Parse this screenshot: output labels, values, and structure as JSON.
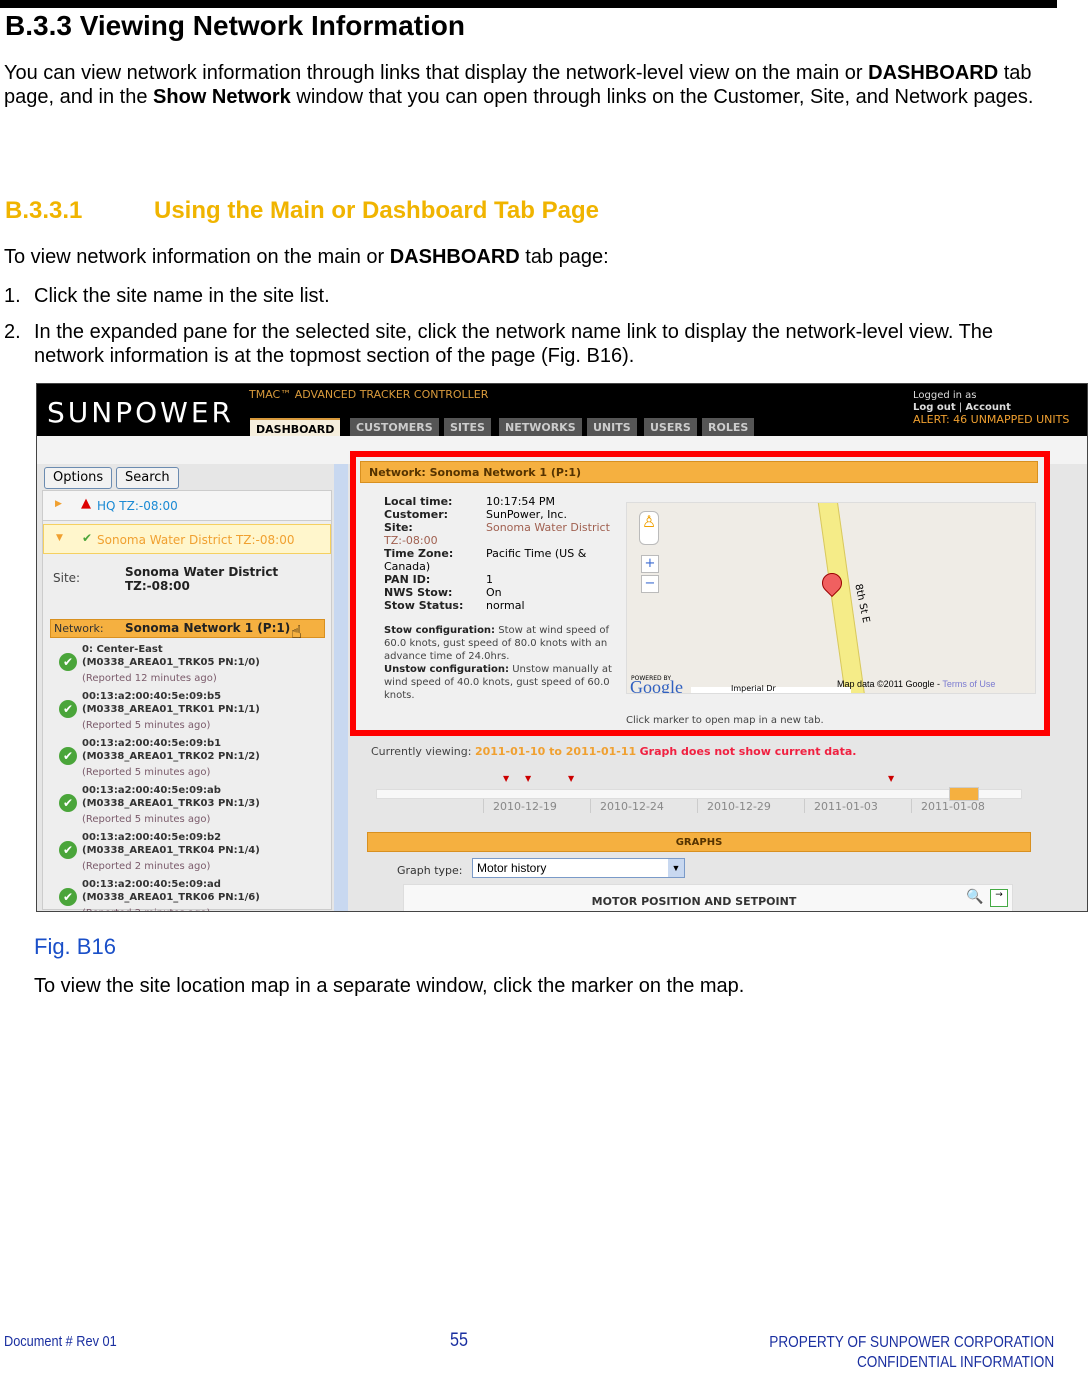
{
  "heading": "B.3.3 Viewing Network Information",
  "intro": {
    "t1": "You can view network information through links that display the network-level view on the main or ",
    "b1": "DASHBOARD",
    "t2": " tab page, and in the ",
    "b2": "Show Network",
    "t3": " window that you can open through links on the Customer, Site, and Network pages."
  },
  "section": {
    "number": "B.3.3.1",
    "title": "Using the Main or Dashboard Tab Page"
  },
  "lead": {
    "t1": "To view network information on the main or ",
    "b1": "DASHBOARD",
    "t2": " tab page:"
  },
  "steps": [
    {
      "n": "1.",
      "text": "Click the site name in the site list."
    },
    {
      "n": "2.",
      "text": "In the expanded pane for the selected site, click the network name link to display the network-level view. The network information is at the topmost section of the page (Fig. B16)."
    }
  ],
  "app": {
    "logo": "SUNPOWER",
    "product": "TMAC™ ADVANCED TRACKER CONTROLLER",
    "tabs": [
      "DASHBOARD",
      "CUSTOMERS",
      "SITES",
      "NETWORKS",
      "UNITS",
      "USERS",
      "ROLES"
    ],
    "logged_in": "Logged in as",
    "logout": "Log out",
    "sep": "|",
    "account": "Account",
    "alert": "ALERT: 46 UNMAPPED UNITS",
    "options": "Options",
    "search": "Search",
    "site_hq": "HQ TZ:-08:00",
    "site_sonoma": "Sonoma Water District TZ:-08:00",
    "site_label": "Site:",
    "site_value": "Sonoma Water District TZ:-08:00",
    "network_label": "Network:",
    "network_value": "Sonoma Network 1 (P:1)",
    "units": [
      {
        "id": "0: Center-East (M0338_AREA01_TRK05 PN:1/0)",
        "reported": "(Reported 12 minutes ago)"
      },
      {
        "id": "00:13:a2:00:40:5e:09:b5 (M0338_AREA01_TRK01 PN:1/1)",
        "reported": "(Reported 5 minutes ago)"
      },
      {
        "id": "00:13:a2:00:40:5e:09:b1 (M0338_AREA01_TRK02 PN:1/2)",
        "reported": "(Reported 5 minutes ago)"
      },
      {
        "id": "00:13:a2:00:40:5e:09:ab (M0338_AREA01_TRK03 PN:1/3)",
        "reported": "(Reported 5 minutes ago)"
      },
      {
        "id": "00:13:a2:00:40:5e:09:b2 (M0338_AREA01_TRK04 PN:1/4)",
        "reported": "(Reported 2 minutes ago)"
      },
      {
        "id": "00:13:a2:00:40:5e:09:ad (M0338_AREA01_TRK06 PN:1/6)",
        "reported": "(Reported 2 minutes ago)"
      }
    ],
    "net_title": "Network: Sonoma Network 1 (P:1)",
    "info": {
      "local_time_l": "Local time:",
      "local_time": "10:17:54 PM",
      "customer_l": "Customer:",
      "customer": "SunPower, Inc.",
      "site_l": "Site:",
      "site": "Sonoma Water District TZ:-08:00",
      "tz_l": "Time Zone:",
      "tz": "Pacific Time (US & Canada)",
      "pan_l": "PAN ID:",
      "pan": "1",
      "nws_l": "NWS Stow:",
      "nws": "On",
      "stow_l": "Stow Status:",
      "stow": "normal",
      "stowcfg_l": "Stow configuration:",
      "stowcfg": "Stow at wind speed of 60.0 knots, gust speed of 80.0 knots with an advance time of 24.0hrs.",
      "unstow_l": "Unstow configuration:",
      "unstow": "Unstow manually at wind speed of 40.0 knots, gust speed of 60.0 knots."
    },
    "map": {
      "street": "8th St E",
      "street2": "Imperial Dr",
      "powered": "POWERED BY",
      "google": "Google",
      "mapdata": "Map data ©2011 Google -",
      "terms": "Terms of Use",
      "hint": "Click marker to open map in a new tab.",
      "zoom_in": "+",
      "zoom_out": "−"
    },
    "viewing_l": "Currently viewing:",
    "viewing_range": "2011-01-10 to 2011-01-11",
    "viewing_warn": "Graph does not show current data.",
    "timeline": [
      "2010-12-19",
      "2010-12-24",
      "2010-12-29",
      "2011-01-03",
      "2011-01-08"
    ],
    "graphs": "GRAPHS",
    "graph_type_l": "Graph type:",
    "graph_type": "Motor history",
    "graph_title": "MOTOR POSITION AND SETPOINT"
  },
  "caption": "Fig. B16",
  "after": "To view the site location map in a separate window, click the marker on the map.",
  "footer": {
    "doc": "Document #  Rev 01",
    "page": "55",
    "prop": "PROPERTY OF SUNPOWER CORPORATION",
    "conf": "CONFIDENTIAL INFORMATION"
  },
  "colors": {
    "heading2": "#f0b400",
    "accent": "#f5b040",
    "highlight": "#ff0000",
    "link": "#1a4fc8"
  }
}
